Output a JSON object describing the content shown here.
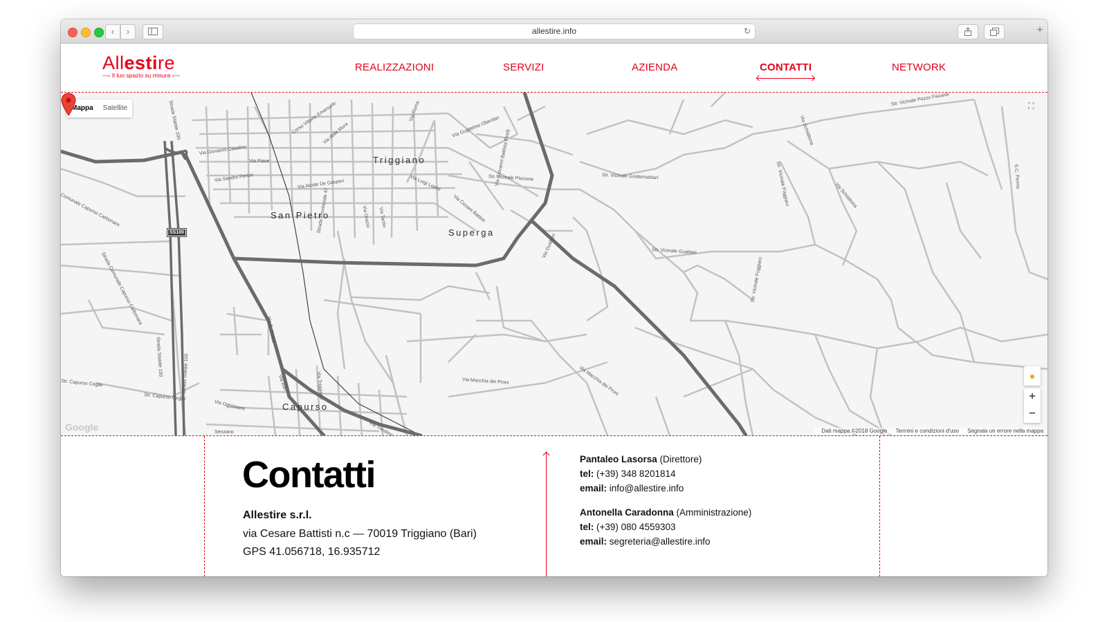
{
  "browser": {
    "url": "allestire.info"
  },
  "site": {
    "logo": {
      "pre": "All",
      "bold": "esti",
      "post": "re",
      "tagline": "Il tuo spazio su misura"
    },
    "nav": [
      {
        "label": "REALIZZAZIONI"
      },
      {
        "label": "SERVIZI"
      },
      {
        "label": "AZIENDA"
      },
      {
        "label": "CONTATTI"
      },
      {
        "label": "NETWORK"
      }
    ]
  },
  "map": {
    "type_buttons": {
      "map": "Mappa",
      "satellite": "Satellite"
    },
    "places": {
      "triggiano": "Triggiano",
      "san_pietro": "San Pietro",
      "superga": "Superga",
      "capurso": "Capurso"
    },
    "roads": {
      "r1": "Strada Statale 100",
      "r2": "Via Giovanni Casalino",
      "r3": "Corso Vittorio Emanuele",
      "r4": "Via delle Mura",
      "r5": "Via Piave",
      "r6": "Via Sandro Pertini",
      "r7": "Via Alcide De Gasperi",
      "r8": "Via Guglielmo Oberdan",
      "r9": "Via Roma",
      "r10": "Str. Vicinale Piscione",
      "r11": "Str. Vicinale Grottemaldari",
      "r12": "Via Giovanni Battista Pirelli",
      "r13": "Via Cesare Battisti",
      "r14": "Via Luigi Lopez",
      "r15": "Strada Provinciale 47",
      "r16": "Via Gualtieri",
      "r17": "Str. Vicinale Gualtieri",
      "r18": "Strada Statale 100",
      "r19": "Strada Comunale Capurso Carbonara",
      "r20": "Comunale Capurso Carbonara",
      "r21": "Via S. Pietro",
      "r22": "Via Triggiano",
      "r23": "Via Macchia dei Proni",
      "r24": "Via Macchia dei Proni",
      "r25": "Str. Capurso Ceglie",
      "r26": "Str. Capurso Ceglie",
      "r27": "Via Ognissanti",
      "r28": "Via Bari",
      "r29": "Via Triestina",
      "r30": "Str. Vicinale Pozzo Fiscardi",
      "r31": "Via Schiattona",
      "r32": "Via Schiattona",
      "r33": "Str. Vicinale Foggiaro",
      "r34": "Str. Vicinale Foggiaro",
      "r35": "S.C. Penna",
      "r36": "Via Cesare Battisti",
      "r37": "Via Orazio",
      "r38": "Via Tacito",
      "r39": "Strada Statale 100",
      "r40": "Senzano"
    },
    "shield": "SS100",
    "google": "Google",
    "attribution": [
      "Dati mappa ©2018 Google",
      "Termini e condizioni d'uso",
      "Segnala un errore nella mappa"
    ]
  },
  "contact": {
    "title": "Contatti",
    "company": "Allestire s.r.l.",
    "address": "via Cesare Battisti n.c — 70019 Triggiano (Bari)",
    "gps": "GPS 41.056718, 16.935712",
    "people": [
      {
        "name": "Pantaleo Lasorsa",
        "role": "(Direttore)",
        "tel_label": "tel:",
        "tel": "(+39) 348 8201814",
        "email_label": "email:",
        "email": "info@allestire.info"
      },
      {
        "name": "Antonella Caradonna",
        "role": "(Amministrazione)",
        "tel_label": "tel:",
        "tel": "(+39) 080 4559303",
        "email_label": "email:",
        "email": "segreteria@allestire.info"
      }
    ]
  },
  "colors": {
    "brand": "#e3001b"
  }
}
